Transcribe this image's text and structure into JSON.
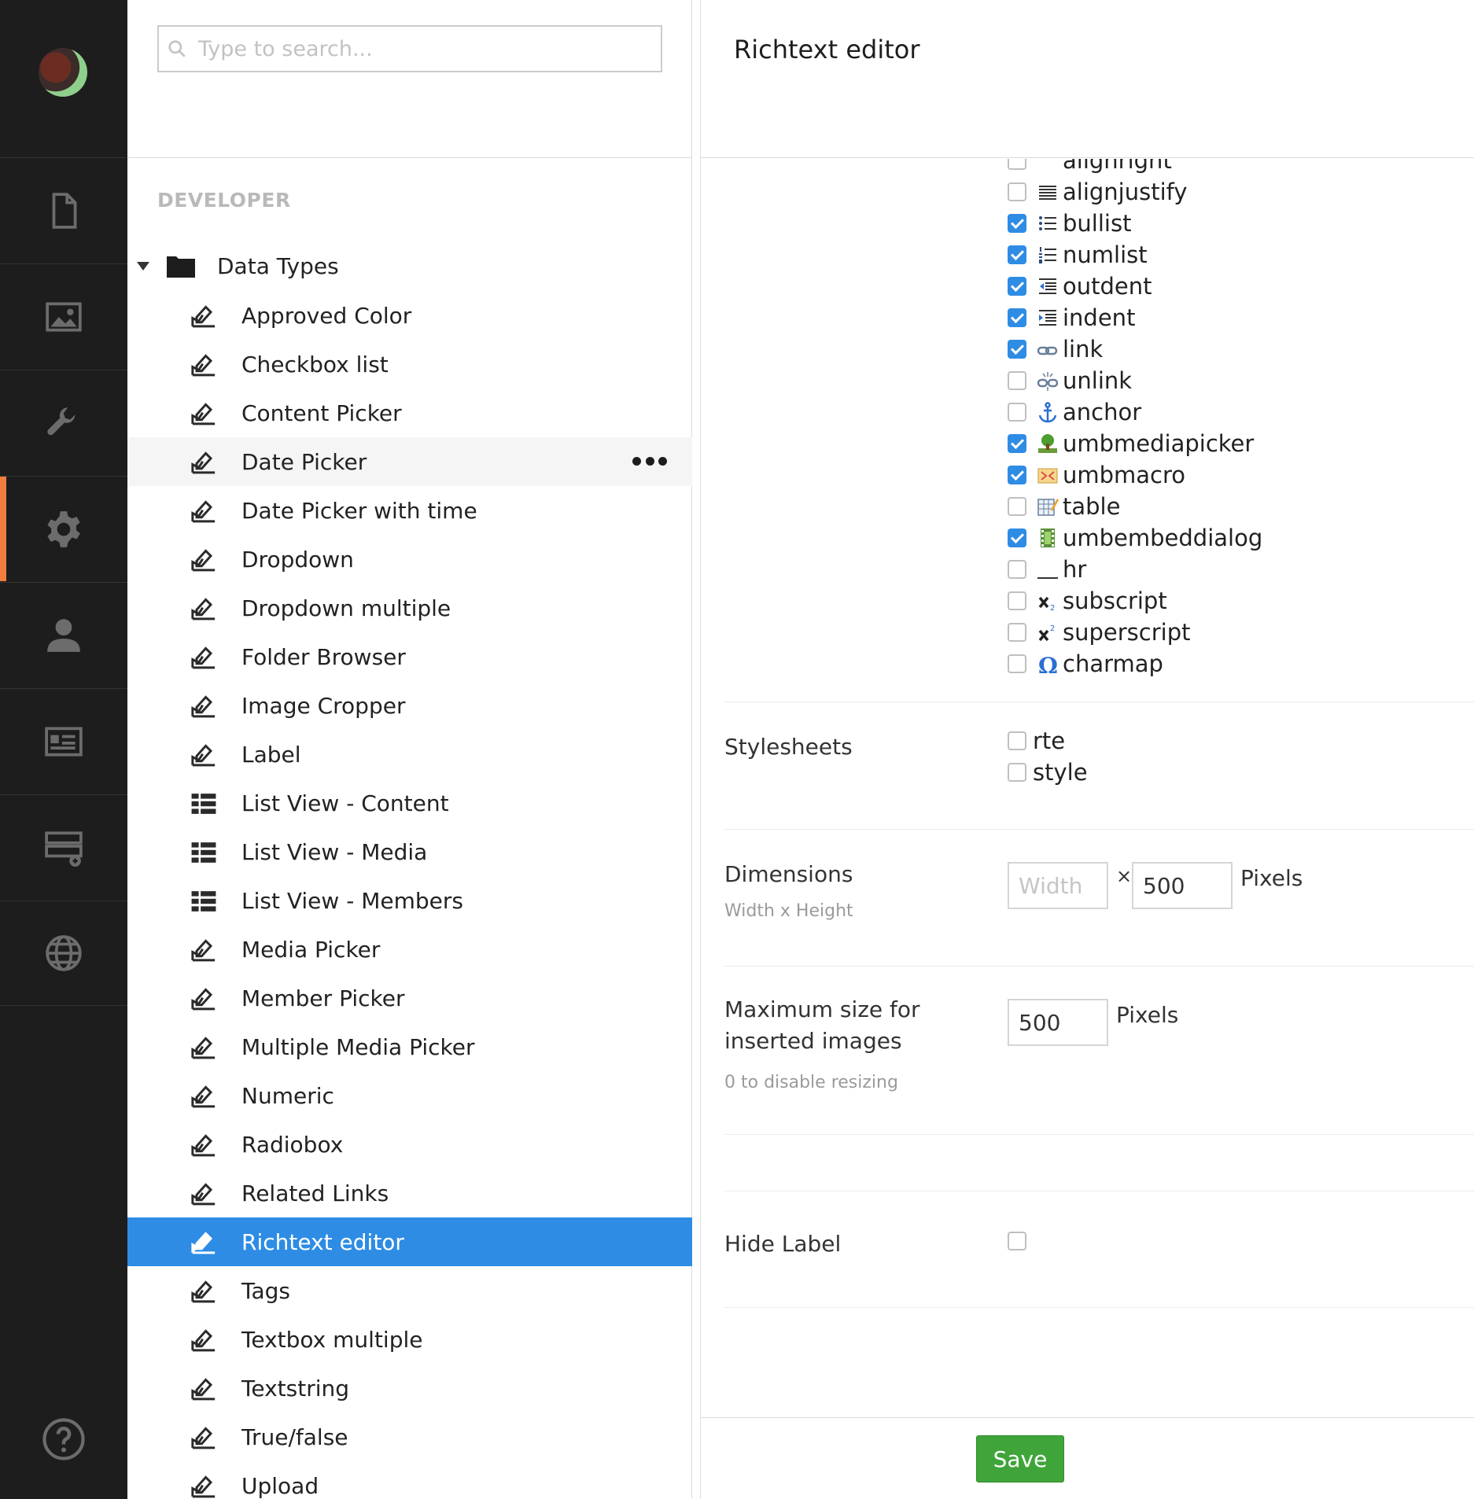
{
  "search": {
    "placeholder": "Type to search..."
  },
  "tree": {
    "section_title": "DEVELOPER",
    "root_label": "Data Types",
    "items": [
      {
        "label": "Approved Color",
        "icon": "edit-icon"
      },
      {
        "label": "Checkbox list",
        "icon": "edit-icon"
      },
      {
        "label": "Content Picker",
        "icon": "edit-icon"
      },
      {
        "label": "Date Picker",
        "icon": "edit-icon"
      },
      {
        "label": "Date Picker with time",
        "icon": "edit-icon"
      },
      {
        "label": "Dropdown",
        "icon": "edit-icon"
      },
      {
        "label": "Dropdown multiple",
        "icon": "edit-icon"
      },
      {
        "label": "Folder Browser",
        "icon": "edit-icon"
      },
      {
        "label": "Image Cropper",
        "icon": "edit-icon"
      },
      {
        "label": "Label",
        "icon": "edit-icon"
      },
      {
        "label": "List View - Content",
        "icon": "list-view-icon"
      },
      {
        "label": "List View - Media",
        "icon": "list-view-icon"
      },
      {
        "label": "List View - Members",
        "icon": "list-view-icon"
      },
      {
        "label": "Media Picker",
        "icon": "edit-icon"
      },
      {
        "label": "Member Picker",
        "icon": "edit-icon"
      },
      {
        "label": "Multiple Media Picker",
        "icon": "edit-icon"
      },
      {
        "label": "Numeric",
        "icon": "edit-icon"
      },
      {
        "label": "Radiobox",
        "icon": "edit-icon"
      },
      {
        "label": "Related Links",
        "icon": "edit-icon"
      },
      {
        "label": "Richtext editor",
        "icon": "edit-icon"
      },
      {
        "label": "Tags",
        "icon": "edit-icon"
      },
      {
        "label": "Textbox multiple",
        "icon": "edit-icon"
      },
      {
        "label": "Textstring",
        "icon": "edit-icon"
      },
      {
        "label": "True/false",
        "icon": "edit-icon"
      },
      {
        "label": "Upload",
        "icon": "edit-icon"
      }
    ],
    "hover_item": "Date Picker",
    "selected_item": "Richtext editor"
  },
  "rail": {
    "items": [
      "content-icon",
      "media-icon",
      "settings-wrench-icon",
      "developer-gear-icon",
      "users-icon",
      "members-icon",
      "forms-icon",
      "translation-globe-icon"
    ],
    "active": "developer-gear-icon",
    "help_icon": "help-icon"
  },
  "editor": {
    "title": "Richtext editor",
    "toolbar": [
      {
        "label": "alignright",
        "checked": false,
        "icon": "align-right-icon"
      },
      {
        "label": "alignjustify",
        "checked": false,
        "icon": "align-justify-icon"
      },
      {
        "label": "bullist",
        "checked": true,
        "icon": "bullet-list-icon"
      },
      {
        "label": "numlist",
        "checked": true,
        "icon": "numbered-list-icon"
      },
      {
        "label": "outdent",
        "checked": true,
        "icon": "outdent-icon"
      },
      {
        "label": "indent",
        "checked": true,
        "icon": "indent-icon"
      },
      {
        "label": "link",
        "checked": true,
        "icon": "link-icon"
      },
      {
        "label": "unlink",
        "checked": false,
        "icon": "unlink-icon"
      },
      {
        "label": "anchor",
        "checked": false,
        "icon": "anchor-icon"
      },
      {
        "label": "umbmediapicker",
        "checked": true,
        "icon": "media-picker-icon"
      },
      {
        "label": "umbmacro",
        "checked": true,
        "icon": "macro-icon"
      },
      {
        "label": "table",
        "checked": false,
        "icon": "table-icon"
      },
      {
        "label": "umbembeddialog",
        "checked": true,
        "icon": "embed-icon"
      },
      {
        "label": "hr",
        "checked": false,
        "icon": "horizontal-rule-icon"
      },
      {
        "label": "subscript",
        "checked": false,
        "icon": "subscript-icon"
      },
      {
        "label": "superscript",
        "checked": false,
        "icon": "superscript-icon"
      },
      {
        "label": "charmap",
        "checked": false,
        "icon": "charmap-icon"
      }
    ],
    "stylesheets": {
      "label": "Stylesheets",
      "options": [
        {
          "label": "rte",
          "checked": false
        },
        {
          "label": "style",
          "checked": false
        }
      ]
    },
    "dimensions": {
      "label": "Dimensions",
      "description": "Width x Height",
      "width_value": "",
      "width_placeholder": "Width",
      "times": "×",
      "height_value": "500",
      "unit": "Pixels"
    },
    "max_image_size": {
      "label_line1": "Maximum size for",
      "label_line2": "inserted images",
      "description": "0 to disable resizing",
      "value": "500",
      "unit": "Pixels"
    },
    "hide_label": {
      "label": "Hide Label",
      "checked": false
    },
    "save_label": "Save"
  },
  "colors": {
    "rail_bg": "#1d1d1d",
    "accent": "#f27d3d",
    "selected": "#2e8ce4",
    "save": "#3fa53a"
  }
}
